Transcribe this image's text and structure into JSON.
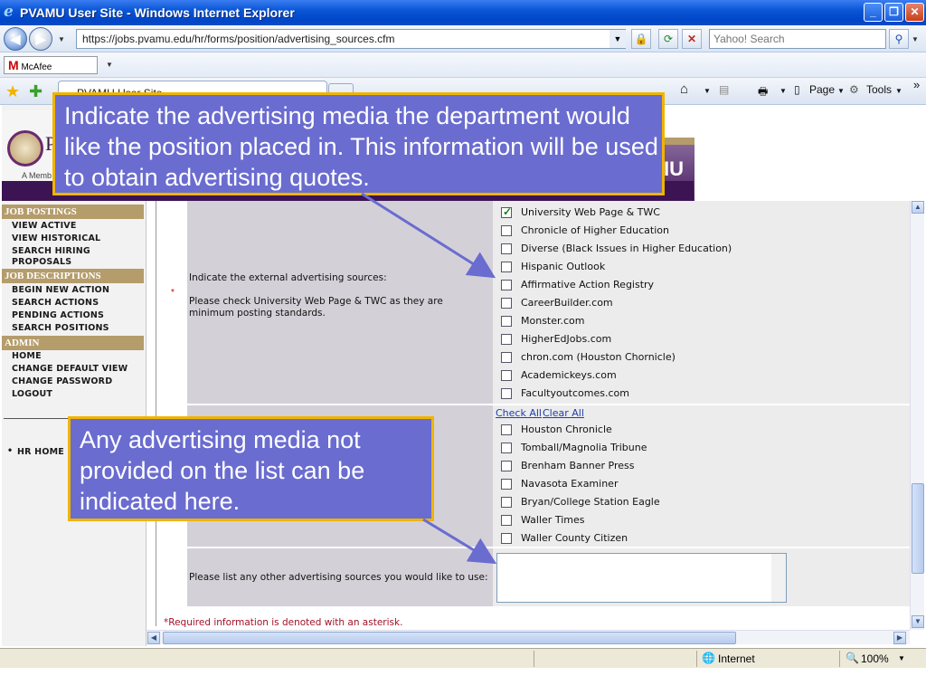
{
  "window": {
    "title": "PVAMU User Site - Windows Internet Explorer",
    "minimize": "_",
    "restore": "❐",
    "close": "✕"
  },
  "browser": {
    "address": "https://jobs.pvamu.edu/hr/forms/position/advertising_sources.cfm",
    "search_placeholder": "Yahoo! Search",
    "mcafee_label": "McAfee SiteAdvisor",
    "tab_title": "PVAMU User Site",
    "page_menu": "Page",
    "tools_menu": "Tools",
    "chevron": "»"
  },
  "banner": {
    "letter": "P",
    "tagline": "A Memb",
    "mu": "IU"
  },
  "sidebar": {
    "sections": [
      {
        "title": "JOB POSTINGS",
        "items": [
          "VIEW ACTIVE",
          "VIEW HISTORICAL",
          "SEARCH HIRING",
          "PROPOSALS"
        ]
      },
      {
        "title": "JOB DESCRIPTIONS",
        "items": [
          "BEGIN NEW ACTION",
          "SEARCH ACTIONS",
          "PENDING ACTIONS",
          "SEARCH POSITIONS"
        ]
      },
      {
        "title": "ADMIN",
        "items": [
          "HOME",
          "CHANGE DEFAULT VIEW",
          "CHANGE PASSWORD",
          "LOGOUT"
        ]
      }
    ],
    "hr_home": "HR HOME"
  },
  "form": {
    "external_label": "Indicate the external advertising sources:",
    "external_note": "Please check University Web Page & TWC as they are minimum posting standards.",
    "required_mark": "*",
    "external_options": [
      {
        "label": "University Web Page & TWC",
        "checked": true
      },
      {
        "label": "Chronicle of Higher Education",
        "checked": false
      },
      {
        "label": "Diverse (Black Issues in Higher Education)",
        "checked": false
      },
      {
        "label": "Hispanic Outlook",
        "checked": false
      },
      {
        "label": "Affirmative Action Registry",
        "checked": false
      },
      {
        "label": "CareerBuilder.com",
        "checked": false
      },
      {
        "label": "Monster.com",
        "checked": false
      },
      {
        "label": "HigherEdJobs.com",
        "checked": false
      },
      {
        "label": "chron.com (Houston Chornicle)",
        "checked": false
      },
      {
        "label": "Academickeys.com",
        "checked": false
      },
      {
        "label": "Facultyoutcomes.com",
        "checked": false
      }
    ],
    "check_all": "Check All",
    "clear_all": "Clear All",
    "local_options": [
      {
        "label": "Houston Chronicle",
        "checked": false
      },
      {
        "label": "Tomball/Magnolia Tribune",
        "checked": false
      },
      {
        "label": "Brenham Banner Press",
        "checked": false
      },
      {
        "label": "Navasota Examiner",
        "checked": false
      },
      {
        "label": "Bryan/College Station Eagle",
        "checked": false
      },
      {
        "label": "Waller Times",
        "checked": false
      },
      {
        "label": "Waller County Citizen",
        "checked": false
      }
    ],
    "other_label": "Please list any other advertising sources you would like to use:",
    "other_value": "",
    "required_note": "*Required information is denoted with an asterisk."
  },
  "status": {
    "zone": "Internet",
    "zoom": "100%"
  },
  "callouts": {
    "top": "Indicate the advertising media the department would like the position placed in. This information will be used to obtain advertising quotes.",
    "bottom": "Any advertising media not provided on the list can be indicated here."
  },
  "colors": {
    "callout_bg": "#6a6cd0",
    "callout_border": "#f0b400",
    "nav_section": "#b59c6b",
    "brand_purple": "#3c1454"
  }
}
